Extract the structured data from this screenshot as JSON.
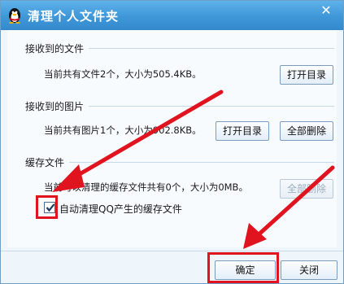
{
  "dialog": {
    "title": "清理个人文件夹",
    "close_symbol": "✕"
  },
  "received_files": {
    "heading": "接收到的文件",
    "info": "当前共有文件2个，大小为505.4KB。",
    "open_label": "打开目录"
  },
  "received_images": {
    "heading": "接收到的图片",
    "info": "当前共有图片1个，大小为902.8KB。",
    "open_label": "打开目录",
    "delete_label": "全部删除"
  },
  "cache_files": {
    "heading": "缓存文件",
    "info": "当前可以清理的缓存文件共有0个，大小为0MB。",
    "delete_label": "全部删除",
    "auto_clean_label": "自动清理QQ产生的缓存文件",
    "auto_clean_checked": true
  },
  "footer": {
    "ok_label": "确定",
    "close_label": "关闭"
  },
  "annotation": {
    "color": "#e0141e"
  }
}
